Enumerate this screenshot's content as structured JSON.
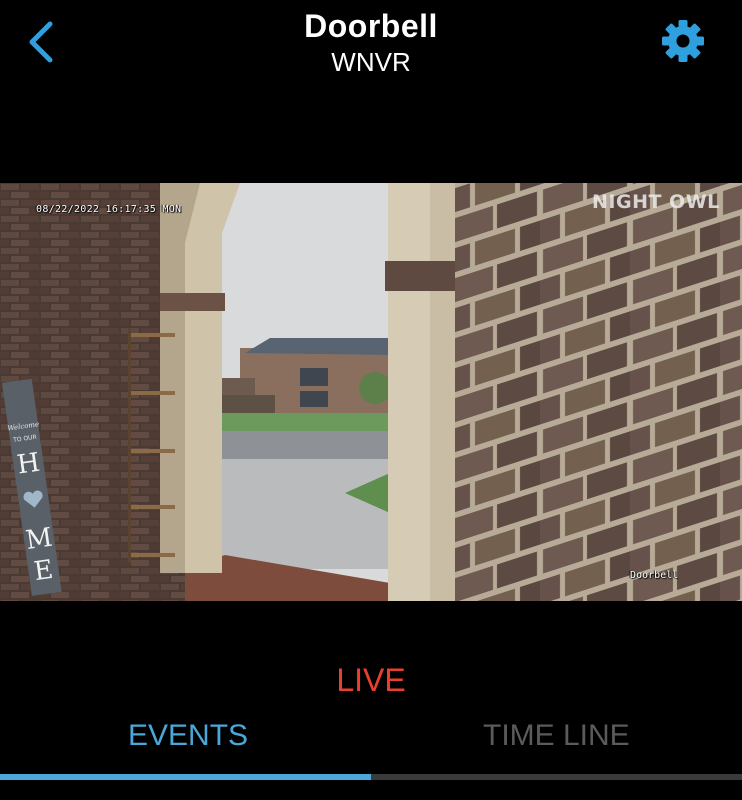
{
  "header": {
    "title": "Doorbell",
    "subtitle": "WNVR",
    "back_icon": "chevron-left-icon",
    "settings_icon": "gear-icon",
    "accent_color": "#2f9fde"
  },
  "video": {
    "timestamp": "08/22/2022 16:17:35 MON",
    "watermark": "NIGHT OWL",
    "camera_label": "Doorbell",
    "sign_text": [
      "Welcome",
      "TO OUR",
      "H",
      "M",
      "E"
    ]
  },
  "live_label": "LIVE",
  "live_color": "#e8402f",
  "tabs": [
    {
      "label": "EVENTS",
      "active": true
    },
    {
      "label": "TIME LINE",
      "active": false
    }
  ],
  "tab_colors": {
    "active": "#4aa7d8",
    "inactive": "#5b5b5b"
  }
}
